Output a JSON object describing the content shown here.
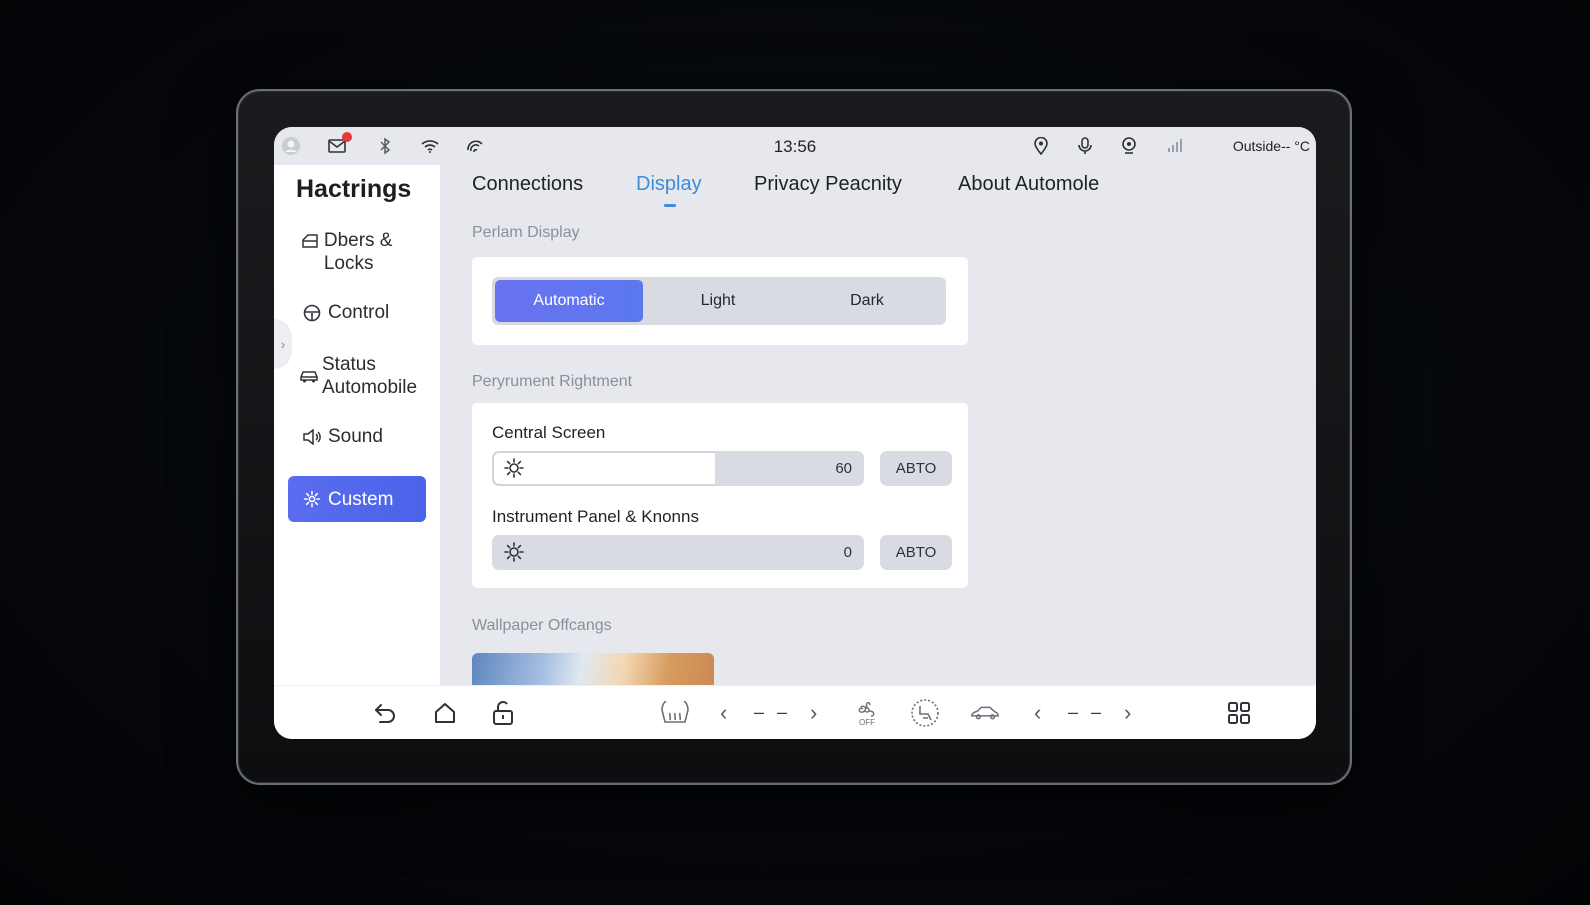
{
  "status_bar": {
    "time": "13:56",
    "outside_temp": "Outside-- °C",
    "icons_left": [
      "avatar-icon",
      "mail-icon",
      "bluetooth-icon",
      "wifi-icon",
      "signal-arc-icon"
    ],
    "icons_right": [
      "location-pin-icon",
      "microphone-icon",
      "map-pin-icon",
      "cellular-signal-icon"
    ]
  },
  "sidebar": {
    "title": "Hactrings",
    "items": [
      {
        "label": "Dbers & Locks",
        "icon": "car-door-icon"
      },
      {
        "label": "Control",
        "icon": "steering-wheel-icon"
      },
      {
        "label": "Status Automobile",
        "icon": "car-icon"
      },
      {
        "label": "Sound",
        "icon": "speaker-icon"
      },
      {
        "label": "Custem",
        "icon": "gear-icon",
        "active": true
      }
    ]
  },
  "tabs": [
    {
      "label": "Connections"
    },
    {
      "label": "Display",
      "active": true
    },
    {
      "label": "Privacy Peacnity"
    },
    {
      "label": "About Automole"
    }
  ],
  "display_mode": {
    "section_label": "Perlam Display",
    "options": [
      "Automatic",
      "Light",
      "Dark"
    ],
    "selected": "Automatic"
  },
  "brightness": {
    "section_label": "Peryrument Rightment",
    "central_screen": {
      "label": "Central Screen",
      "value": "60",
      "level_percent": 60,
      "auto_label": "ABTO"
    },
    "instrument_panel": {
      "label": "Instrument Panel & Knonns",
      "value": "0",
      "level_percent": 0,
      "auto_label": "ABTO"
    }
  },
  "wallpaper": {
    "section_label": "Wallpaper Offcangs"
  },
  "bottom_bar": {
    "left_temp": "– –",
    "right_temp": "– –",
    "fan_label": "OFF"
  },
  "colors": {
    "accent": "#4a63e8",
    "tab_active": "#3d8bd9",
    "notification": "#e53935"
  }
}
